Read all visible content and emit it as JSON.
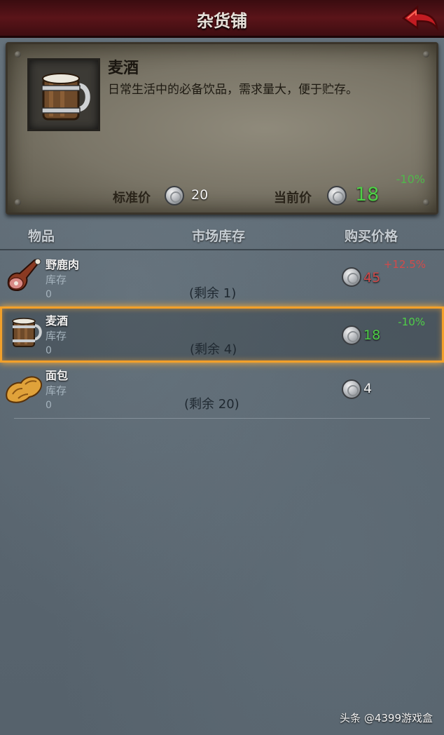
{
  "header": {
    "title": "杂货铺"
  },
  "detail": {
    "name": "麦酒",
    "description": "日常生活中的必备饮品，需求量大，便于贮存。",
    "price_modifier": "-10%",
    "standard_price_label": "标准价",
    "standard_price": "20",
    "current_price_label": "当前价",
    "current_price": "18",
    "icon": "ale-mug-icon"
  },
  "columns": {
    "item": "物品",
    "stock": "市场库存",
    "price": "购买价格"
  },
  "items": [
    {
      "name": "野鹿肉",
      "stock_label": "库存",
      "stock": "0",
      "remaining": "(剩余 1)",
      "price": "45",
      "modifier": "+12.5%",
      "price_color": "#d24a4a",
      "modifier_color": "#d24a4a",
      "icon": "venison-icon"
    },
    {
      "name": "麦酒",
      "stock_label": "库存",
      "stock": "0",
      "remaining": "(剩余 4)",
      "price": "18",
      "modifier": "-10%",
      "price_color": "#4fcf47",
      "modifier_color": "#4fcf47",
      "icon": "ale-mug-icon",
      "selected": true
    },
    {
      "name": "面包",
      "stock_label": "库存",
      "stock": "0",
      "remaining": "(剩余 20)",
      "price": "4",
      "modifier": "",
      "price_color": "#f2f2f2",
      "modifier_color": "#f2f2f2",
      "icon": "bread-icon"
    }
  ],
  "watermark": "头条 @4399游戏盒"
}
